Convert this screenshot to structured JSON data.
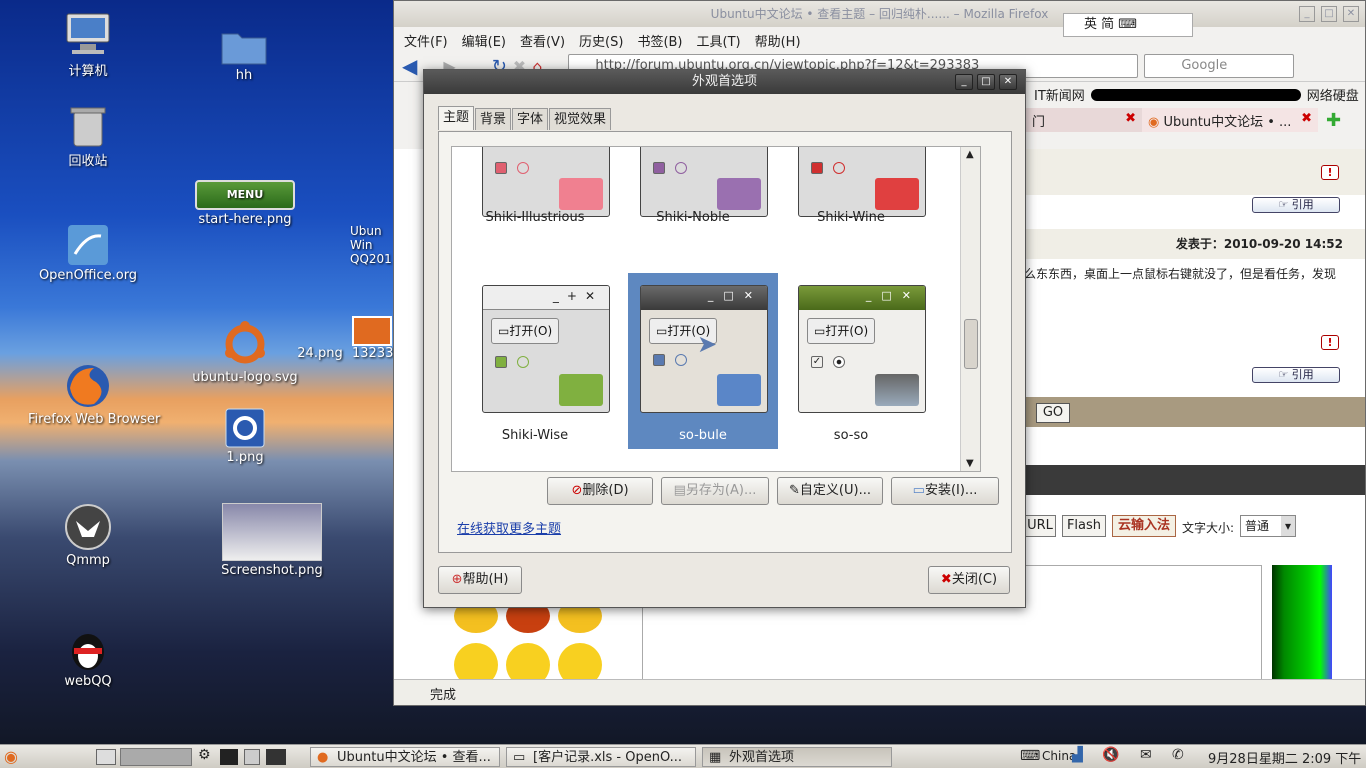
{
  "desktop": {
    "icons": [
      {
        "label": "计算机"
      },
      {
        "label": "hh"
      },
      {
        "label": "回收站"
      },
      {
        "label": "start-here.png"
      },
      {
        "label": "OpenOffice.org"
      },
      {
        "label": "ubuntu-logo.svg"
      },
      {
        "label": "24.png"
      },
      {
        "label": "Firefox Web Browser"
      },
      {
        "label": "1.png"
      },
      {
        "label": "Qmmp"
      },
      {
        "label": "Screenshot.png"
      },
      {
        "label": "webQQ"
      },
      {
        "label": "Ubun"
      },
      {
        "label": "Win"
      },
      {
        "label": "QQ201"
      },
      {
        "label": "13233"
      }
    ]
  },
  "firefox": {
    "title": "Ubuntu中文论坛 • 查看主题 – 回归纯朴...... – Mozilla Firefox",
    "menu": [
      "文件(F)",
      "编辑(E)",
      "查看(V)",
      "历史(S)",
      "书签(B)",
      "工具(T)",
      "帮助(H)"
    ],
    "url": "http://forum.ubuntu.org.cn/viewtopic.php?f=12&t=293383",
    "search_placeholder": "Google",
    "bookmarks": [
      "IT新闻网",
      "网络硬盘"
    ],
    "tabs": [
      "门",
      "Ubuntu中文论坛 • ..."
    ],
    "quote": "引用",
    "post_time": "发表于：2010-09-20 14:52",
    "post_text": "么东东西，桌面上一点鼠标右键就没了，但是看任务，发现",
    "go": "GO",
    "editor": {
      "url": "URL",
      "flash": "Flash",
      "ime": "云输入法",
      "fontsize_label": "文字大小:",
      "fontsize_value": "普通"
    },
    "status": "完成"
  },
  "ime": {
    "text": "英 简"
  },
  "dialog": {
    "title": "外观首选项",
    "tabs": [
      "主题",
      "背景",
      "字体",
      "视觉效果"
    ],
    "themes": [
      {
        "name": "Shiki-Illustrious"
      },
      {
        "name": "Shiki-Noble"
      },
      {
        "name": "Shiki-Wine"
      },
      {
        "name": "Shiki-Wise",
        "open": "打开(O)"
      },
      {
        "name": "so-bule",
        "open": "打开(O)"
      },
      {
        "name": "so-so",
        "open": "打开(O)"
      }
    ],
    "selected_theme": "so-bule",
    "buttons": {
      "delete": "删除(D)",
      "saveas": "另存为(A)...",
      "custom": "自定义(U)...",
      "install": "安装(I)..."
    },
    "more_link": "在线获取更多主题",
    "help": "帮助(H)",
    "close": "关闭(C)"
  },
  "taskbar": {
    "tasks": [
      "Ubuntu中文论坛 • 查看...",
      "[客户记录.xls - OpenO...",
      "外观首选项"
    ],
    "keyboard": "China",
    "clock": "9月28日星期二  2:09 下午"
  }
}
